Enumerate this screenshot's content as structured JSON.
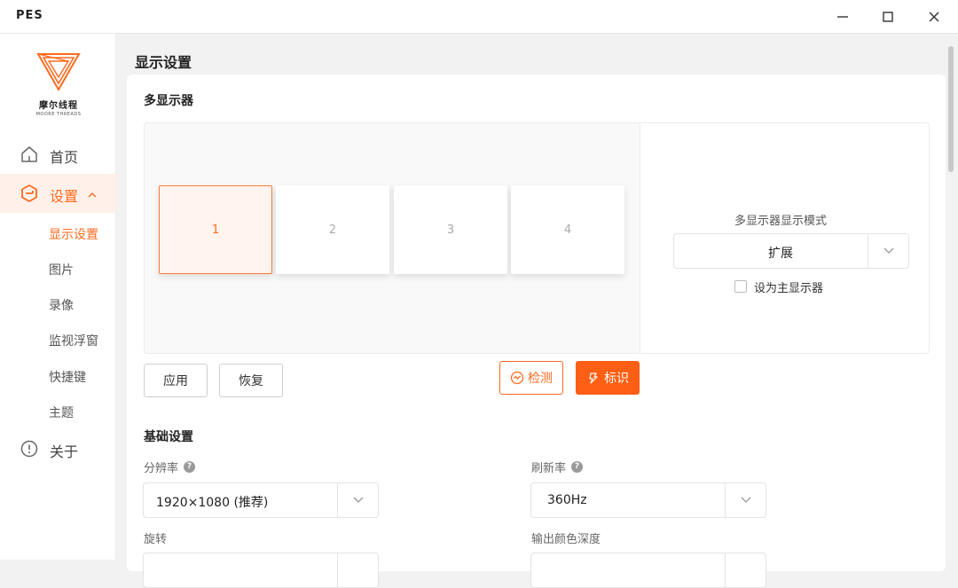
{
  "app": {
    "title": "PES"
  },
  "window": {
    "minimize_icon": "minimize-icon",
    "maximize_icon": "maximize-icon",
    "close_icon": "close-icon"
  },
  "brand": {
    "name_cn": "摩尔线程",
    "name_en": "MOORE THREADS"
  },
  "sidebar": {
    "items": [
      {
        "label": "首页",
        "icon": "home-icon"
      },
      {
        "label": "设置",
        "icon": "settings-icon",
        "active": true,
        "expanded": true
      }
    ],
    "sub_items": [
      {
        "label": "显示设置",
        "active": true
      },
      {
        "label": "图片"
      },
      {
        "label": "录像"
      },
      {
        "label": "监视浮窗"
      },
      {
        "label": "快捷键"
      },
      {
        "label": "主题"
      }
    ],
    "about": {
      "label": "关于",
      "icon": "info-icon"
    }
  },
  "page": {
    "title": "显示设置",
    "multi_display": {
      "title": "多显示器",
      "monitors": [
        {
          "label": "1",
          "active": true
        },
        {
          "label": "2"
        },
        {
          "label": "3"
        },
        {
          "label": "4"
        }
      ],
      "mode_label": "多显示器显示模式",
      "mode_value": "扩展",
      "primary_checkbox": {
        "label": "设为主显示器",
        "checked": false
      },
      "apply_button": "应用",
      "restore_button": "恢复",
      "detect_button": "检测",
      "identify_button": "标识"
    },
    "basic": {
      "title": "基础设置",
      "resolution_label": "分辨率",
      "resolution_value": "1920×1080 (推荐)",
      "refresh_label": "刷新率",
      "refresh_value": "360Hz",
      "rotation_label": "旋转",
      "color_depth_label": "输出颜色深度",
      "help_glyph": "?"
    }
  },
  "colors": {
    "accent": "#ff6a1f",
    "accent_bg": "#fff1ea"
  }
}
